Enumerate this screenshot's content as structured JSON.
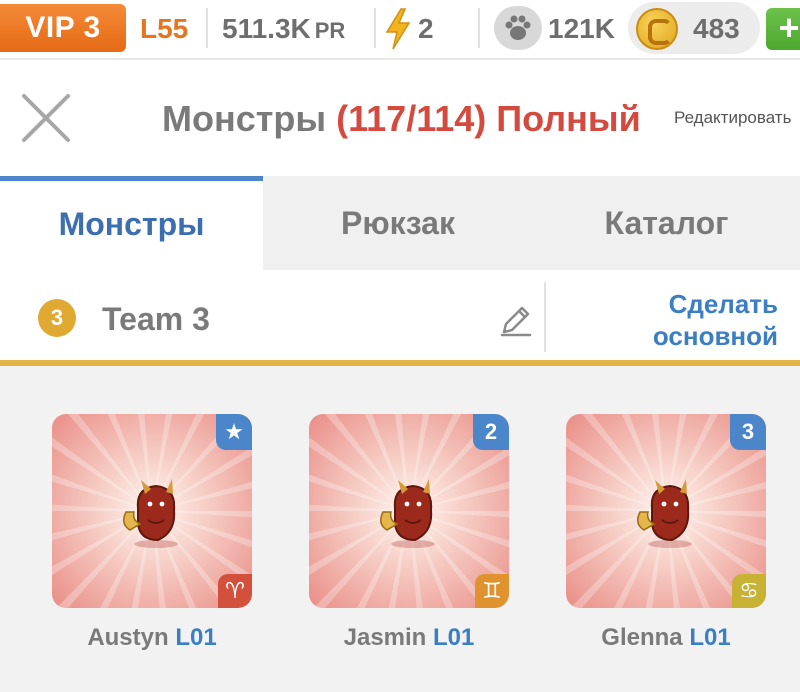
{
  "status_bar": {
    "vip": "VIP 3",
    "level": "L55",
    "power": "511.3K",
    "power_unit": "PR",
    "energy": "2",
    "paw": "121K",
    "coins": "483",
    "plus": "+",
    "icons": [
      "bolt-icon",
      "paw-icon",
      "coin-icon"
    ]
  },
  "header": {
    "title": "Монстры",
    "count": "(117/114) Полный",
    "edit": "Редактировать"
  },
  "tabs": [
    {
      "label": "Монстры",
      "active": true
    },
    {
      "label": "Рюкзак",
      "active": false
    },
    {
      "label": "Каталог",
      "active": false
    }
  ],
  "team": {
    "badge": "3",
    "name": "Team 3",
    "make_main": "Сделать основной"
  },
  "monsters": [
    {
      "name": "Austyn",
      "level": "L01",
      "slot": "★",
      "sign": "♈",
      "sign_color": "#d2503c"
    },
    {
      "name": "Jasmin",
      "level": "L01",
      "slot": "2",
      "sign": "♊",
      "sign_color": "#e0922e"
    },
    {
      "name": "Glenna",
      "level": "L01",
      "slot": "3",
      "sign": "♋",
      "sign_color": "#c7b233"
    }
  ],
  "colors": {
    "accent_blue": "#3b6fb0",
    "full_red": "#d44a3e",
    "vip_orange": "#e56a16",
    "team_gold": "#e3b445"
  }
}
